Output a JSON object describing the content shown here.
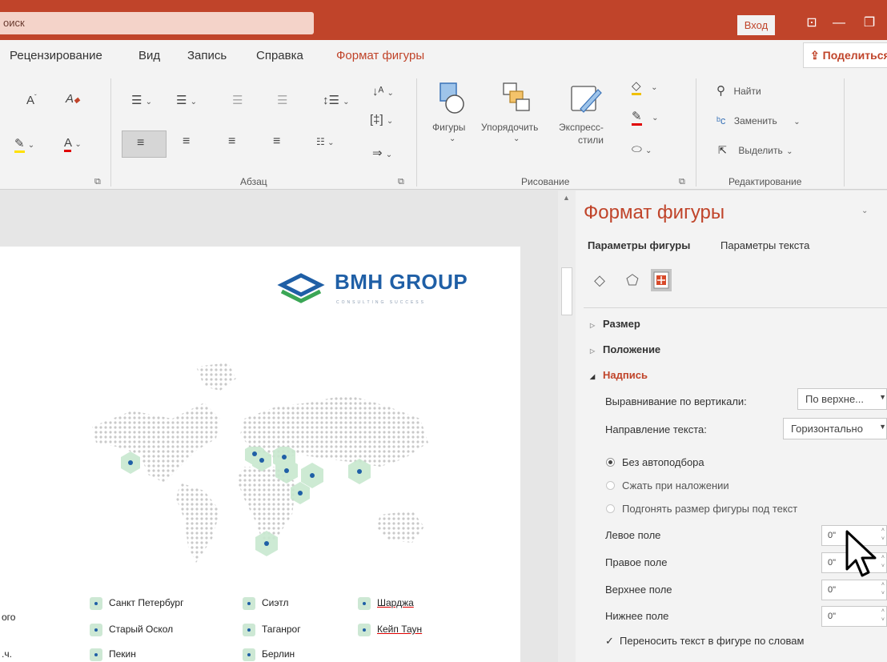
{
  "titlebar": {
    "search_text": "оиск",
    "signin_label": "Вход",
    "ribbon_display_icon": "ribbon-display-icon",
    "minimize_icon": "minimize-icon",
    "restore_icon": "restore-icon"
  },
  "tabs": {
    "items": [
      "Рецензирование",
      "Вид",
      "Запись",
      "Справка",
      "Формат фигуры"
    ],
    "active": "Формат фигуры",
    "share_label": "Поделиться"
  },
  "ribbon": {
    "paragraph_label": "Абзац",
    "drawing_label": "Рисование",
    "editing_label": "Редактирование",
    "shapes_label": "Фигуры",
    "arrange_label": "Упорядочить",
    "quick_styles_label": "Экспресс-",
    "quick_styles_label2": "стили",
    "find_label": "Найти",
    "replace_label": "Заменить",
    "select_label": "Выделить"
  },
  "slide": {
    "logo_text": "BMH GROUP",
    "logo_sub": "CONSULTING SUCCESS",
    "cities": [
      [
        "Санкт Петербург",
        "Сиэтл",
        "Шарджа"
      ],
      [
        "Старый Оскол",
        "Таганрог",
        "Кейп Таун"
      ],
      [
        "Пекин",
        "Берлин"
      ]
    ],
    "left_cut_text_1": "ого",
    "left_cut_text_2": ".ч."
  },
  "pane": {
    "title": "Формат фигуры",
    "tabs": [
      "Параметры фигуры",
      "Параметры текста"
    ],
    "sections": {
      "size": "Размер",
      "position": "Положение",
      "textbox": "Надпись"
    },
    "vertical_align_label": "Выравнивание по вертикали:",
    "vertical_align_value": "По верхне...",
    "text_direction_label": "Направление текста:",
    "text_direction_value": "Горизонтально",
    "autofit_options": [
      "Без автоподбора",
      "Сжать при наложении",
      "Подгонять размер фигуры под текст"
    ],
    "autofit_selected": 0,
    "margins": [
      {
        "label": "Левое поле",
        "value": "0\""
      },
      {
        "label": "Правое поле",
        "value": "0\""
      },
      {
        "label": "Верхнее поле",
        "value": "0\""
      },
      {
        "label": "Нижнее поле",
        "value": "0\""
      }
    ],
    "wrap_label": "Переносить текст в фигуре по словам",
    "wrap_checked": true
  },
  "colors": {
    "accent": "#c0442a",
    "logo_blue": "#1f5fa6",
    "logo_green": "#3aa655"
  }
}
